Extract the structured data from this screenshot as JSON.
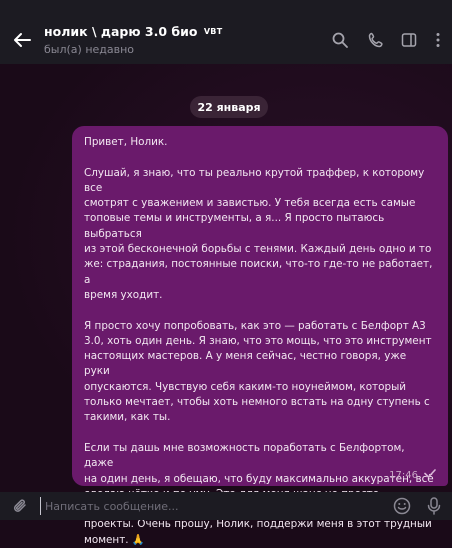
{
  "header": {
    "title": "нолик \\ дарю 3.0 био",
    "title_badge": "VBT",
    "status": "был(а) недавно",
    "icons": [
      "back-arrow-icon",
      "search-icon",
      "phone-icon",
      "sidebar-toggle-icon",
      "more-vertical-icon"
    ]
  },
  "chat": {
    "date_separator": "22 января",
    "message": {
      "paragraphs": [
        "Привет, Нолик.",
        "Слушай, я знаю, что ты реально крутой траффер, к которому все\nсмотрят с уважением и завистью. У тебя всегда есть самые\nтоповые темы и инструменты, а я... Я просто пытаюсь выбраться\nиз этой бесконечной борьбы с тенями. Каждый день одно и то\nже: страдания, постоянные поиски, что-то где-то не работает, а\nвремя уходит.",
        "Я просто хочу попробовать, как это — работать с Белфорт А3\n3.0, хоть один день. Я знаю, что это мощь, что это инструмент\nнастоящих мастеров. А у меня сейчас, честно говоря, уже руки\nопускаются. Чувствую себя каким-то ноунеймом, который\nтолько мечтает, чтобы хоть немного встать на одну ступень с\nтакими, как ты.",
        "Если ты дашь мне возможность поработать с Белфортом, даже\nна один день, я обещаю, что буду максимально аккуратен, всё\nсделаю чётко и по уму. Это для меня шанс не просто\nпопробовать, а, возможно, вдохнуть новую жизнь в мои\nпроекты. Очень прошу, Нолик, поддержи меня в этот трудный\nмомент. 🙏"
      ],
      "time": "17:46",
      "read_status": "single-check-icon"
    }
  },
  "composer": {
    "placeholder": "Написать сообщение...",
    "value": ""
  },
  "colors": {
    "header_bg": "#1c1b22",
    "chat_bg": "#1a0a18",
    "bubble_bg": "#6a1a6b",
    "date_pill_bg": "#3a2436"
  }
}
